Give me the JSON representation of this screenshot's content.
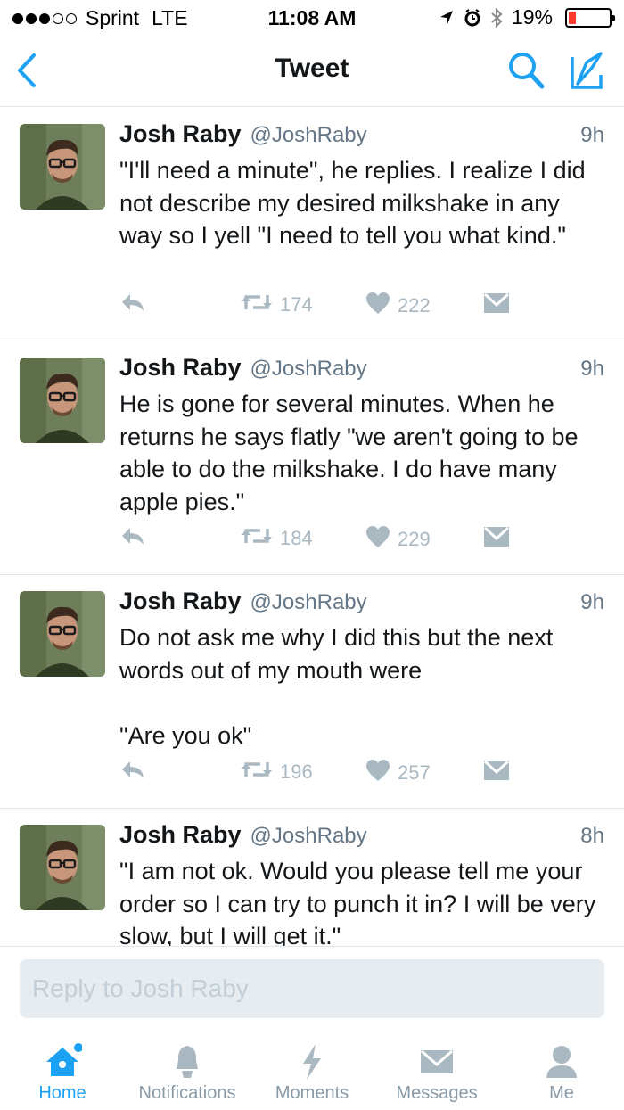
{
  "status_bar": {
    "carrier": "Sprint",
    "network": "LTE",
    "time": "11:08 AM",
    "battery_percent": "19%",
    "battery_level": 0.19,
    "signal_bars_filled": 3,
    "signal_bars_total": 5
  },
  "nav": {
    "title": "Tweet",
    "icons": [
      "back-chevron-icon",
      "search-icon",
      "compose-icon"
    ]
  },
  "colors": {
    "accent": "#1da1f2",
    "icon_gray": "#aab8c2",
    "secondary_text": "#657786"
  },
  "tweets": [
    {
      "name": "Josh Raby",
      "handle": "@JoshRaby",
      "time": "9h",
      "text": "\"I'll need a minute\", he replies. I realize I did not describe my desired milkshake in any way so I yell \"I need to tell you what kind.\"",
      "retweets": "174",
      "likes": "222"
    },
    {
      "name": "Josh Raby",
      "handle": "@JoshRaby",
      "time": "9h",
      "text": "He is gone for several minutes. When he returns he says flatly \"we aren't going to be able to do the milkshake. I do have many apple pies.\"",
      "retweets": "184",
      "likes": "229"
    },
    {
      "name": "Josh Raby",
      "handle": "@JoshRaby",
      "time": "9h",
      "text": "Do not ask me why I did this but the next words out of my mouth were\n\n\"Are you ok\"",
      "retweets": "196",
      "likes": "257"
    },
    {
      "name": "Josh Raby",
      "handle": "@JoshRaby",
      "time": "8h",
      "text": "\"I am not ok. Would you please tell me your order so I can try to punch it in? I will be very slow, but I will get it.\"",
      "retweets": "",
      "likes": ""
    }
  ],
  "reply": {
    "placeholder": "Reply to Josh Raby"
  },
  "tabs": [
    {
      "label": "Home",
      "icon": "home-icon",
      "active": true
    },
    {
      "label": "Notifications",
      "icon": "bell-icon",
      "active": false
    },
    {
      "label": "Moments",
      "icon": "lightning-icon",
      "active": false
    },
    {
      "label": "Messages",
      "icon": "envelope-icon",
      "active": false
    },
    {
      "label": "Me",
      "icon": "person-icon",
      "active": false
    }
  ]
}
